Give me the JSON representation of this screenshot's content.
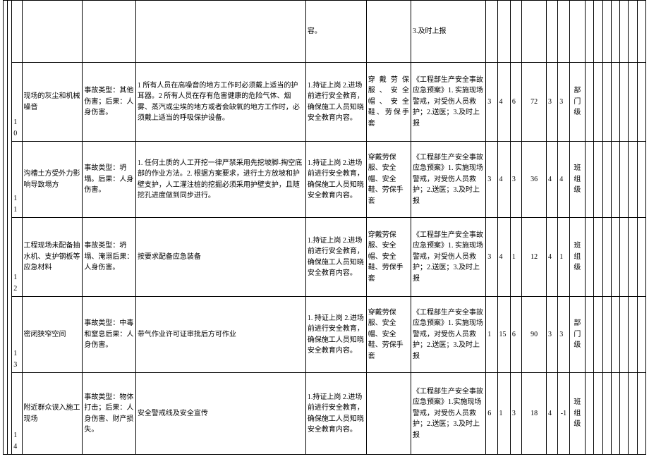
{
  "rows": [
    {
      "idx": "",
      "work": "",
      "type": "",
      "measure": "",
      "train": "容。",
      "ppe": "",
      "plan": "3.及时上报",
      "n1": "",
      "n2": "",
      "n3": "",
      "n4": "",
      "n5": "",
      "n6": "",
      "level": ""
    },
    {
      "idx": "10",
      "work": "现场的灰尘和机械噪音",
      "type": "事故类型：其他伤害；后果：人身伤害。",
      "measure": "1 所有人员在高噪音的地方工作时必须戴上适当的护耳器。2 所有人员在存有危害健康的危险气体、烟雾、蒸汽或尘埃的地方或者会缺氧的地方工作时，必须戴上适当的呼吸保护设备。",
      "train": "1.持证上岗 2.进场前进行安全教育，确保施工人员知晓安全教育内容。",
      "ppe": "穿戴劳保服、安全帽、安全鞋、劳保手套",
      "plan": "《工程部生产安全事故应急预案》1. 实施现场警戒，对受伤人员救护；2.送医；3.及时上报",
      "n1": "3",
      "n2": "4",
      "n3": "6",
      "n4": "72",
      "n5": "3",
      "n6": "3",
      "level": "部门级"
    },
    {
      "idx": "11",
      "work": "沟槽土方受外力影响导致塌方",
      "type": "事故类型：坍塌。后果：人身伤害。",
      "measure": "1. 任何土质的人工开挖一律严禁采用先挖坡脚-掏空底部的作业方法。2. 根据方案要求，进行土方放坡和护壁支护，人工灌注桩的挖掘必须采用护壁支护，且随挖孔进度做到同步进行。",
      "train": "1.持证上岗 2.进场前进行安全教育，确保施工人员知晓安全教育内容。",
      "ppe": "穿戴劳保服、安全帽、安全鞋、劳保手套",
      "plan": "《工程部生产安全事故应急预案》1. 实施现场警戒，对受伤人员救护；2.送医；3.及时上报",
      "n1": "3",
      "n2": "4",
      "n3": "3",
      "n4": "36",
      "n5": "4",
      "n6": "4",
      "level": "班组级"
    },
    {
      "idx": "12",
      "work": "工程现场未配备抽水机、支护钢板等应急材料",
      "type": "事故类型：坍塌、淹溺后果：人身伤害。",
      "measure": "按要求配备应急装备",
      "train": "1.持证上岗 2.进场前进行安全教育，确保施工人员知晓安全教育内容。",
      "ppe": "穿戴劳保服、安全帽、安全鞋、劳保手套",
      "plan": "《工程部生产安全事故应急预案》1. 实施现场警戒，对受伤人员救护；2.送医；3.及时上报",
      "n1": "3",
      "n2": "4",
      "n3": "1",
      "n4": "12",
      "n5": "4",
      "n6": "1",
      "level": "班组级"
    },
    {
      "idx": "13",
      "work": "密闭狭窄空间",
      "type": "事故类型：中毒和窒息后果：人身伤害。",
      "measure": "带气作业许可证审批后方可作业",
      "train": "1. 持证上岗 2.进场前进行安全教育，确保施工人员知晓安全教育内容。",
      "ppe": "穿戴劳保服、安全帽、安全鞋、劳保手套",
      "plan": "《工程部生产安全事故应急预案》1. 实施现场警戒，对受伤人员救护；2.送医；3.及时上报",
      "n1": "1",
      "n2": "15",
      "n3": "6",
      "n4": "90",
      "n5": "3",
      "n6": "3",
      "level": "部门级"
    },
    {
      "idx": "14",
      "work": "附近群众误入施工现场",
      "type": "事故类型：物体打击；后果：人身伤害、财产损失。",
      "measure": "安全警戒线及安全宣传",
      "train": "1.持证上岗 2.进场前进行安全教育，确保施工人员知晓安全教育内容。",
      "ppe": "",
      "plan": "《工程部生产安全事故应急预案》1.实施现场警戒，对受伤人员救护；2.送医；3.及时上报",
      "n1": "6",
      "n2": "1",
      "n3": "3",
      "n4": "18",
      "n5": "4",
      "n6": "-1",
      "level": "班组级"
    }
  ]
}
